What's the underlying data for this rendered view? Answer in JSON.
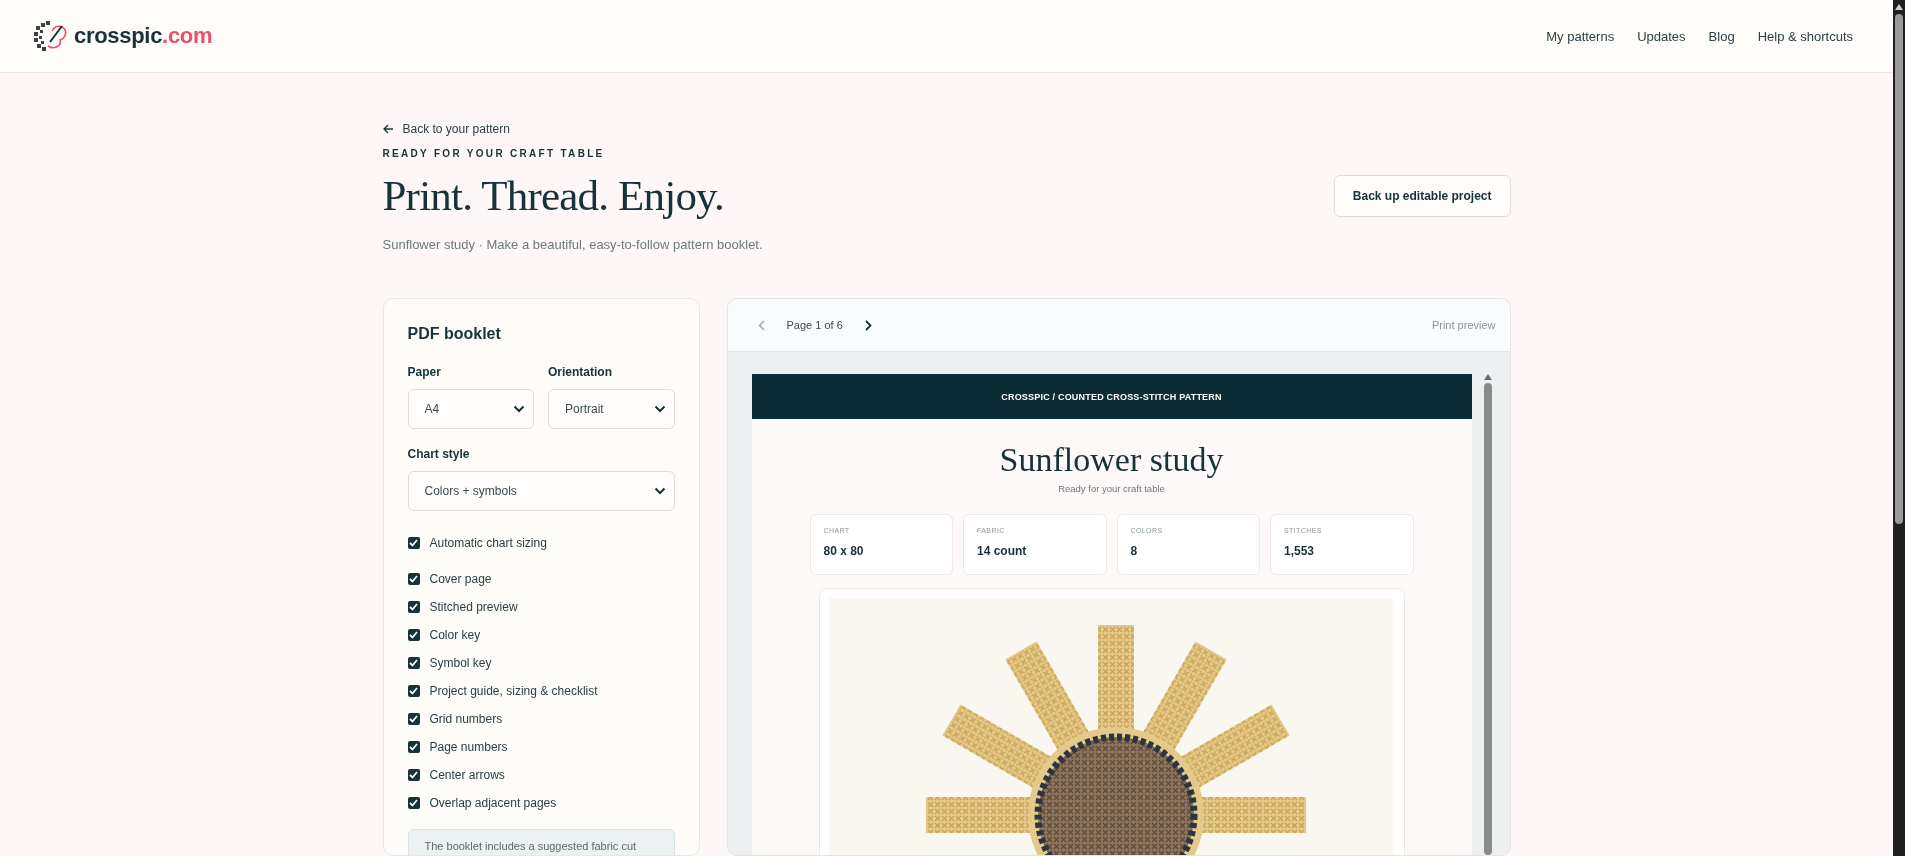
{
  "header": {
    "logo": {
      "name": "crosspic",
      "suffix": ".com"
    },
    "nav": [
      "My patterns",
      "Updates",
      "Blog",
      "Help & shortcuts"
    ]
  },
  "intro": {
    "back_link": "Back to your pattern",
    "eyebrow": "READY FOR YOUR CRAFT TABLE",
    "title": "Print. Thread. Enjoy.",
    "subtitle": "Sunflower study · Make a beautiful, easy-to-follow pattern booklet.",
    "backup_button": "Back up editable project"
  },
  "booklet": {
    "title": "PDF booklet",
    "fields": [
      {
        "label": "Paper",
        "value": "A4"
      },
      {
        "label": "Orientation",
        "value": "Portrait"
      },
      {
        "label": "Chart style",
        "value": "Colors + symbols"
      }
    ],
    "auto_sizing": {
      "label": "Automatic chart sizing",
      "checked": true
    },
    "contents": [
      {
        "label": "Cover page",
        "checked": true
      },
      {
        "label": "Stitched preview",
        "checked": true
      },
      {
        "label": "Color key",
        "checked": true
      },
      {
        "label": "Symbol key",
        "checked": true
      },
      {
        "label": "Project guide, sizing & checklist",
        "checked": true
      },
      {
        "label": "Grid numbers",
        "checked": true
      },
      {
        "label": "Page numbers",
        "checked": true
      },
      {
        "label": "Center arrows",
        "checked": true
      },
      {
        "label": "Overlap adjacent pages",
        "checked": true
      }
    ],
    "note": "The booklet includes a suggested fabric cut"
  },
  "preview": {
    "page": "Page 1 of 6",
    "mode": "Print preview",
    "document": {
      "banner": "CROSSPIC / COUNTED CROSS-STITCH PATTERN",
      "title": "Sunflower study",
      "subtitle": "Ready for your craft table",
      "stats": [
        {
          "label": "CHART",
          "value": "80 x 80"
        },
        {
          "label": "FABRIC",
          "value": "14 count"
        },
        {
          "label": "COLORS",
          "value": "8"
        },
        {
          "label": "STITCHES",
          "value": "1,553"
        }
      ]
    }
  }
}
